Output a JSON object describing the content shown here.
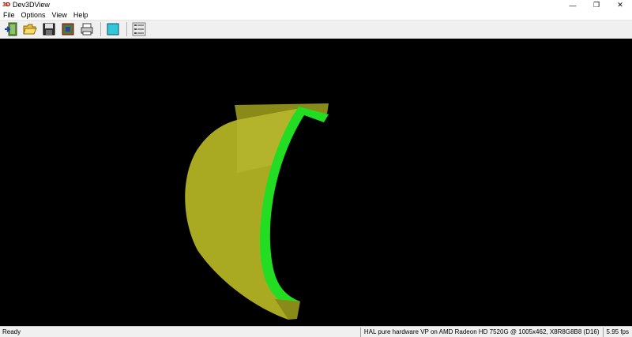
{
  "window": {
    "title": "Dev3DView",
    "app_icon_text": "3D",
    "controls": {
      "minimize": "—",
      "maximize": "❐",
      "close": "✕"
    }
  },
  "menu": {
    "items": [
      {
        "label": "File"
      },
      {
        "label": "Options"
      },
      {
        "label": "View"
      },
      {
        "label": "Help"
      }
    ]
  },
  "toolbar": {
    "buttons": [
      "exit-icon",
      "open-folder-icon",
      "save-icon",
      "snapshot-icon",
      "print-icon",
      "background-color-icon",
      "groups-icon"
    ]
  },
  "viewport": {
    "background": "#000000",
    "surface_color": "#b8b820",
    "edge_color": "#22dd22"
  },
  "status": {
    "main": "Ready",
    "renderer": "HAL pure hardware VP on AMD Radeon HD 7520G @ 1005x462, X8R8G8B8 (D16)",
    "fps": "5.95 fps"
  }
}
